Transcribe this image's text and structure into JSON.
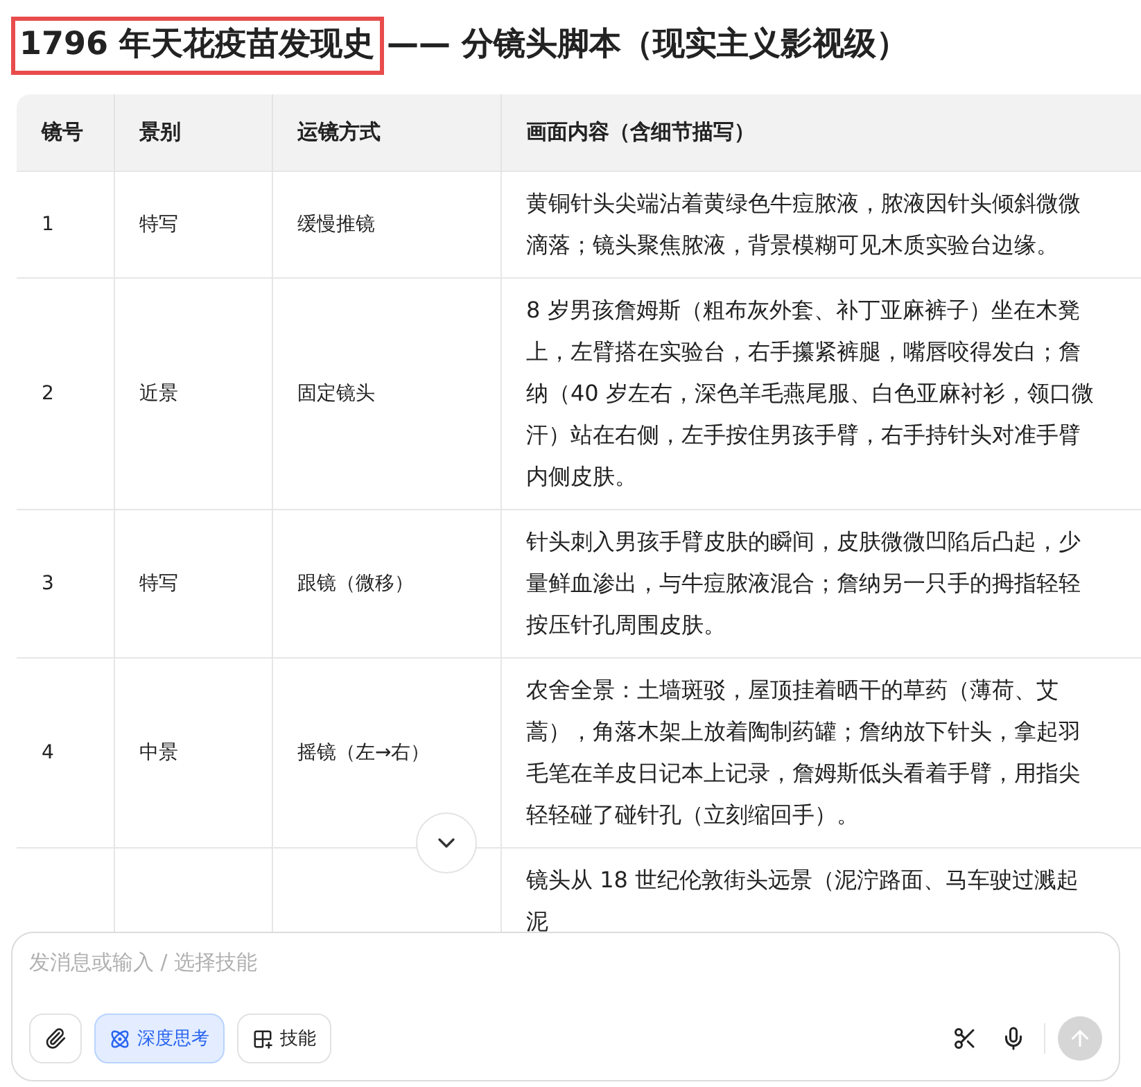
{
  "title": {
    "highlight": "1796 年天花疫苗发现史",
    "rest": "—— 分镜头脚本（现实主义影视级）"
  },
  "table": {
    "columns": [
      "镜号",
      "景别",
      "运镜方式",
      "画面内容（含细节描写）"
    ],
    "rows": [
      {
        "shot": "1",
        "scale": "特写",
        "movement": "缓慢推镜",
        "content": "黄铜针头尖端沾着黄绿色牛痘脓液，脓液因针头倾斜微微滴落；镜头聚焦脓液，背景模糊可见木质实验台边缘。"
      },
      {
        "shot": "2",
        "scale": "近景",
        "movement": "固定镜头",
        "content": "8 岁男孩詹姆斯（粗布灰外套、补丁亚麻裤子）坐在木凳上，左臂搭在实验台，右手攥紧裤腿，嘴唇咬得发白；詹纳（40 岁左右，深色羊毛燕尾服、白色亚麻衬衫，领口微汗）站在右侧，左手按住男孩手臂，右手持针头对准手臂内侧皮肤。"
      },
      {
        "shot": "3",
        "scale": "特写",
        "movement": "跟镜（微移）",
        "content": "针头刺入男孩手臂皮肤的瞬间，皮肤微微凹陷后凸起，少量鲜血渗出，与牛痘脓液混合；詹纳另一只手的拇指轻轻按压针孔周围皮肤。"
      },
      {
        "shot": "4",
        "scale": "中景",
        "movement": "摇镜（左→右）",
        "content": "农舍全景：土墙斑驳，屋顶挂着晒干的草药（薄荷、艾蒿），角落木架上放着陶制药罐；詹纳放下针头，拿起羽毛笔在羊皮日记本上记录，詹姆斯低头看着手臂，用指尖轻轻碰了碰针孔（立刻缩回手）。"
      },
      {
        "shot": "",
        "scale": "",
        "movement": "",
        "content": "镜头从 18 世纪伦敦街头远景（泥泞路面、马车驶过溅起泥"
      }
    ]
  },
  "composer": {
    "placeholder": "发消息或输入 / 选择技能",
    "tools": [
      {
        "kind": "attach"
      },
      {
        "kind": "deep_think",
        "label": "深度思考",
        "selected": true
      },
      {
        "kind": "skills",
        "label": "技能",
        "selected": false
      }
    ],
    "send": {
      "disabled": true
    }
  }
}
